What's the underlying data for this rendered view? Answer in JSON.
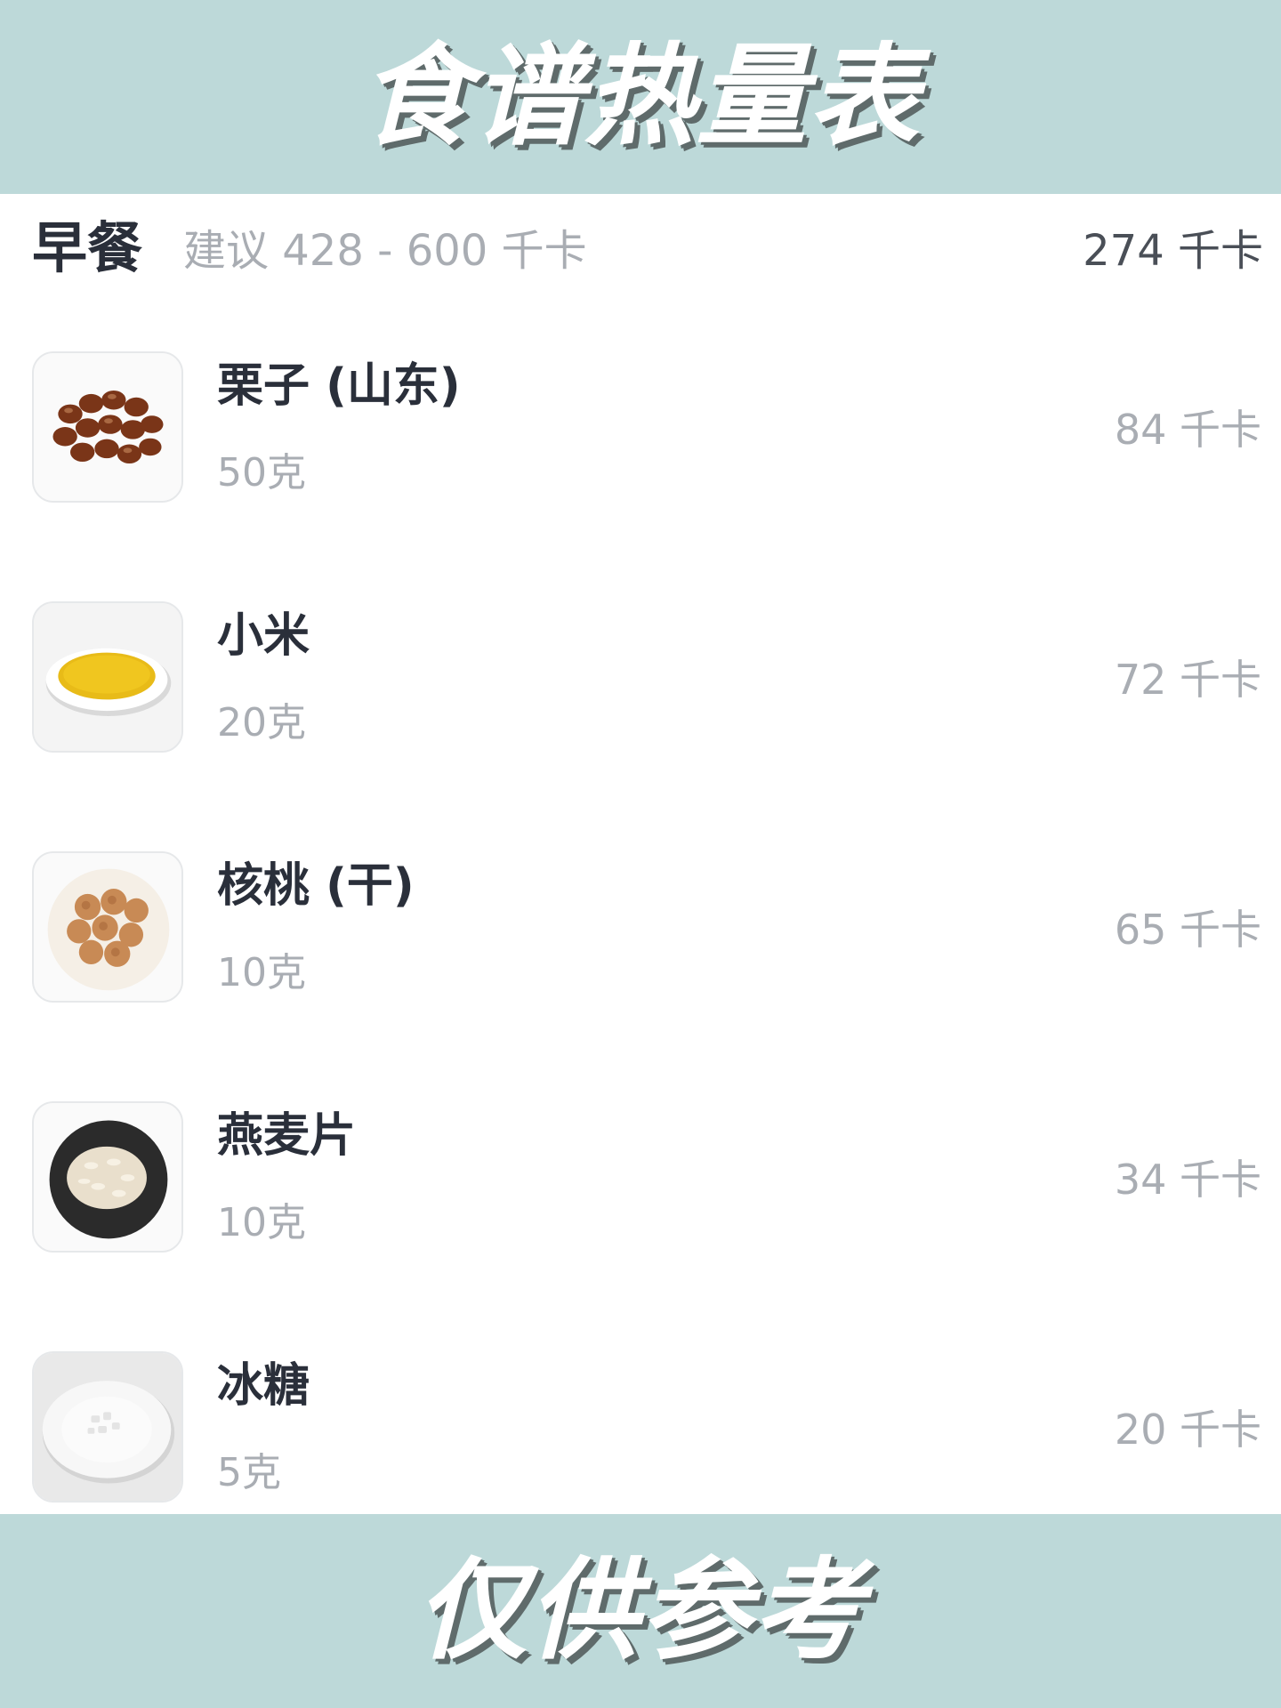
{
  "header": {
    "title": "食谱热量表"
  },
  "meal": {
    "title": "早餐",
    "suggestion": "建议 428 - 600 千卡",
    "total": "274 千卡"
  },
  "foods": [
    {
      "name": "栗子 (山东)",
      "amount": "50克",
      "kcal": "84 千卡",
      "icon": "chestnut-icon"
    },
    {
      "name": "小米",
      "amount": "20克",
      "kcal": "72 千卡",
      "icon": "millet-icon"
    },
    {
      "name": "核桃 (干)",
      "amount": "10克",
      "kcal": "65 千卡",
      "icon": "walnut-icon"
    },
    {
      "name": "燕麦片",
      "amount": "10克",
      "kcal": "34 千卡",
      "icon": "oatmeal-icon"
    },
    {
      "name": "冰糖",
      "amount": "5克",
      "kcal": "20 千卡",
      "icon": "rock-sugar-icon"
    }
  ],
  "footer": {
    "note": "仅供参考"
  },
  "colors": {
    "banner": "#bdd9d9",
    "title_text": "#ffffff",
    "muted": "#a9adb3",
    "dark": "#2a2f3a"
  }
}
